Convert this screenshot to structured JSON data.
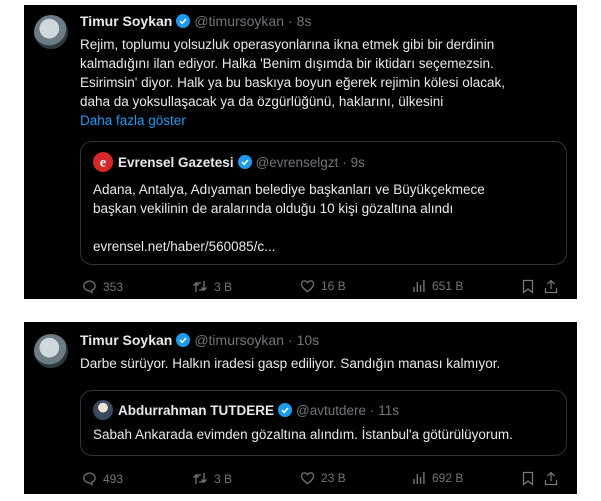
{
  "tweets": [
    {
      "author": "Timur Soykan",
      "handle": "@timursoykan",
      "time": "· 8s",
      "text_lines": [
        "Rejim, toplumu yolsuzluk operasyonlarına ikna etmek gibi bir derdinin",
        "kalmadığını ilan ediyor. Halka 'Benim dışımda bir iktidarı seçemezsin.",
        "Esirimsin' diyor. Halk ya bu baskıya boyun eğerek rejimin kölesi olacak,",
        "daha da yoksullaşacak ya da özgürlüğünü, haklarını, ülkesini"
      ],
      "show_more": "Daha fazla göster",
      "quote": {
        "author": "Evrensel Gazetesi",
        "handle": "@evrenselgzt",
        "time": "· 9s",
        "text_lines": [
          "Adana, Antalya, Adıyaman belediye başkanları ve Büyükçekmece",
          "başkan vekilinin de aralarında olduğu 10 kişi gözaltına alındı"
        ],
        "link": "evrensel.net/haber/560085/c..."
      },
      "stats": {
        "replies": "353",
        "retweets": "3 B",
        "likes": "16 B",
        "views": "651 B"
      }
    },
    {
      "author": "Timur Soykan",
      "handle": "@timursoykan",
      "time": "· 10s",
      "text_lines": [
        "Darbe sürüyor. Halkın iradesi gasp ediliyor. Sandığın manası kalmıyor."
      ],
      "quote": {
        "author": "Abdurrahman TUTDERE",
        "handle": "@avtutdere",
        "time": "· 11s",
        "text_lines": [
          "Sabah Ankarada evimden gözaltına alındım. İstanbul'a götürülüyorum."
        ]
      },
      "stats": {
        "replies": "493",
        "retweets": "3 B",
        "likes": "23 B",
        "views": "692 B"
      }
    }
  ],
  "icons": [
    "verified-badge-icon",
    "reply-icon",
    "retweet-icon",
    "like-icon",
    "views-icon",
    "bookmark-icon",
    "share-icon"
  ],
  "colors": {
    "background": "#000000",
    "text": "#e7e9ea",
    "muted": "#71767b",
    "link": "#1d9bf0",
    "verified": "#1d9bf0",
    "border": "#2f3336",
    "evrensel_logo": "#d62828"
  }
}
